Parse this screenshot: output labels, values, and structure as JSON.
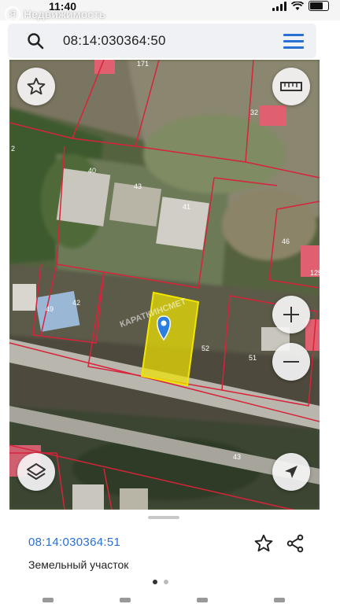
{
  "status_bar": {
    "time": "11:40"
  },
  "watermark": {
    "logo_letter": "Я",
    "text": "Недвижимость"
  },
  "search": {
    "query": "08:14:030364:50"
  },
  "map": {
    "parcel_labels": [
      "171",
      "32",
      "40",
      "43",
      "41",
      "46",
      "125",
      "49",
      "42",
      "52",
      "51",
      "43",
      "2"
    ],
    "overlay_watermark": "КАРАТКИНСМЕТ"
  },
  "bottom_sheet": {
    "cadastral_number": "08:14:030364:51",
    "object_type": "Земельный участок",
    "pager": {
      "pages": 2,
      "current": 1
    }
  },
  "colors": {
    "accent": "#2a6fd4",
    "parcel_border": "#d8233a",
    "selected_parcel": "#f2e600",
    "pin": "#2a7fe0"
  },
  "icons": [
    "search-icon",
    "menu-icon",
    "star-icon",
    "zoom-in-icon",
    "zoom-out-icon",
    "layers-icon",
    "location-arrow-icon",
    "share-icon",
    "pin-icon"
  ]
}
